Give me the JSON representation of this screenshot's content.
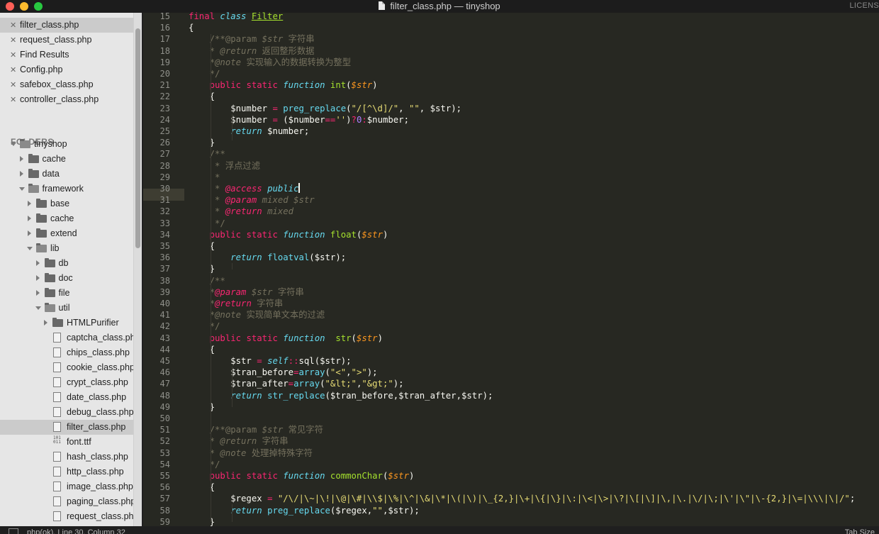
{
  "window": {
    "title": "filter_class.php — tinyshop",
    "right_cut_text": "LICENS"
  },
  "open_files": [
    {
      "label": "filter_class.php",
      "selected": true
    },
    {
      "label": "request_class.php"
    },
    {
      "label": "Find Results"
    },
    {
      "label": "Config.php"
    },
    {
      "label": "safebox_class.php"
    },
    {
      "label": "controller_class.php"
    }
  ],
  "folders_heading": "FOLDERS",
  "tree": [
    {
      "label": "tinyshop",
      "depth": 0,
      "kind": "folder",
      "state": "open"
    },
    {
      "label": "cache",
      "depth": 1,
      "kind": "folder",
      "state": "closed"
    },
    {
      "label": "data",
      "depth": 1,
      "kind": "folder",
      "state": "closed"
    },
    {
      "label": "framework",
      "depth": 1,
      "kind": "folder",
      "state": "open"
    },
    {
      "label": "base",
      "depth": 2,
      "kind": "folder",
      "state": "closed"
    },
    {
      "label": "cache",
      "depth": 2,
      "kind": "folder",
      "state": "closed"
    },
    {
      "label": "extend",
      "depth": 2,
      "kind": "folder",
      "state": "closed"
    },
    {
      "label": "lib",
      "depth": 2,
      "kind": "folder",
      "state": "open"
    },
    {
      "label": "db",
      "depth": 3,
      "kind": "folder",
      "state": "closed"
    },
    {
      "label": "doc",
      "depth": 3,
      "kind": "folder",
      "state": "closed"
    },
    {
      "label": "file",
      "depth": 3,
      "kind": "folder",
      "state": "closed"
    },
    {
      "label": "util",
      "depth": 3,
      "kind": "folder",
      "state": "open"
    },
    {
      "label": "HTMLPurifier",
      "depth": 4,
      "kind": "folder",
      "state": "closed"
    },
    {
      "label": "captcha_class.php",
      "depth": 4,
      "kind": "file"
    },
    {
      "label": "chips_class.php",
      "depth": 4,
      "kind": "file"
    },
    {
      "label": "cookie_class.php",
      "depth": 4,
      "kind": "file"
    },
    {
      "label": "crypt_class.php",
      "depth": 4,
      "kind": "file"
    },
    {
      "label": "date_class.php",
      "depth": 4,
      "kind": "file"
    },
    {
      "label": "debug_class.php",
      "depth": 4,
      "kind": "file"
    },
    {
      "label": "filter_class.php",
      "depth": 4,
      "kind": "file",
      "selected": true
    },
    {
      "label": "font.ttf",
      "depth": 4,
      "kind": "binary"
    },
    {
      "label": "hash_class.php",
      "depth": 4,
      "kind": "file"
    },
    {
      "label": "http_class.php",
      "depth": 4,
      "kind": "file"
    },
    {
      "label": "image_class.php",
      "depth": 4,
      "kind": "file"
    },
    {
      "label": "paging_class.php",
      "depth": 4,
      "kind": "file"
    },
    {
      "label": "request_class.php",
      "depth": 4,
      "kind": "file"
    }
  ],
  "editor": {
    "first_line": 15,
    "current_line": 30,
    "lines": [
      [
        [
          "kw",
          "final "
        ],
        [
          "st",
          "class "
        ],
        [
          "cls",
          "Filter"
        ]
      ],
      [
        [
          "",
          "{"
        ]
      ],
      [
        [
          "cm",
          "    /**@param "
        ],
        [
          "cmi",
          "$str"
        ],
        [
          "cm",
          " 字符串"
        ]
      ],
      [
        [
          "cm",
          "    * "
        ],
        [
          "cmi",
          "@return"
        ],
        [
          "cm",
          " 返回整形数据"
        ]
      ],
      [
        [
          "cm",
          "    *"
        ],
        [
          "cmi",
          "@note"
        ],
        [
          "cm",
          " 实现输入的数据转换为整型"
        ]
      ],
      [
        [
          "cm",
          "    */"
        ]
      ],
      [
        [
          "",
          "    "
        ],
        [
          "kw",
          "public static "
        ],
        [
          "st",
          "function "
        ],
        [
          "fn",
          "int"
        ],
        [
          "",
          "("
        ],
        [
          "vr",
          "$str"
        ],
        [
          "",
          ")"
        ]
      ],
      [
        [
          "",
          "    {"
        ]
      ],
      [
        [
          "",
          "        $number "
        ],
        [
          "kw",
          "= "
        ],
        [
          "ty",
          "preg_replace"
        ],
        [
          "",
          "("
        ],
        [
          "str",
          "\"/[^\\d]/\""
        ],
        [
          ",",
          ", "
        ],
        [
          "str",
          "\"\""
        ],
        [
          "",
          ", $str);"
        ]
      ],
      [
        [
          "",
          "        $number "
        ],
        [
          "kw",
          "= "
        ],
        [
          "",
          "($number"
        ],
        [
          "kw",
          "=="
        ],
        [
          "str",
          "''"
        ],
        [
          "",
          ")"
        ],
        [
          "kw",
          "?"
        ],
        [
          "num",
          "0"
        ],
        [
          "kw",
          ":"
        ],
        [
          "",
          "$number;"
        ]
      ],
      [
        [
          "",
          "        "
        ],
        [
          "st",
          "return "
        ],
        [
          "",
          "$number;"
        ]
      ],
      [
        [
          "",
          "    }"
        ]
      ],
      [
        [
          "cm",
          "    /**"
        ]
      ],
      [
        [
          "cm",
          "     * 浮点过滤"
        ]
      ],
      [
        [
          "cm",
          "     *"
        ]
      ],
      [
        [
          "cm",
          "     * "
        ],
        [
          "cmk",
          "@access "
        ],
        [
          "st",
          "public"
        ]
      ],
      [
        [
          "cm",
          "     * "
        ],
        [
          "cmk",
          "@param "
        ],
        [
          "cmi",
          "mixed $str"
        ]
      ],
      [
        [
          "cm",
          "     * "
        ],
        [
          "cmk",
          "@return "
        ],
        [
          "cmi",
          "mixed"
        ]
      ],
      [
        [
          "cm",
          "     */"
        ]
      ],
      [
        [
          "",
          "    "
        ],
        [
          "kw",
          "public static "
        ],
        [
          "st",
          "function "
        ],
        [
          "fn",
          "float"
        ],
        [
          "",
          "("
        ],
        [
          "vr",
          "$str"
        ],
        [
          "",
          ")"
        ]
      ],
      [
        [
          "",
          "    {"
        ]
      ],
      [
        [
          "",
          "        "
        ],
        [
          "st",
          "return "
        ],
        [
          "ty",
          "floatval"
        ],
        [
          "",
          "($str);"
        ]
      ],
      [
        [
          "",
          "    }"
        ]
      ],
      [
        [
          "cm",
          "    /**"
        ]
      ],
      [
        [
          "cm",
          "    *"
        ],
        [
          "cmk",
          "@param "
        ],
        [
          "cmi",
          "$str"
        ],
        [
          "cm",
          " 字符串"
        ]
      ],
      [
        [
          "cm",
          "    *"
        ],
        [
          "cmk",
          "@return "
        ],
        [
          "cm",
          "字符串"
        ]
      ],
      [
        [
          "cm",
          "    *"
        ],
        [
          "cmi",
          "@note"
        ],
        [
          "cm",
          " 实现简单文本的过滤"
        ]
      ],
      [
        [
          "cm",
          "    */"
        ]
      ],
      [
        [
          "",
          "    "
        ],
        [
          "kw",
          "public static "
        ],
        [
          "st",
          "function  "
        ],
        [
          "fn",
          "str"
        ],
        [
          "",
          "("
        ],
        [
          "vr",
          "$str"
        ],
        [
          "",
          ")"
        ]
      ],
      [
        [
          "",
          "    {"
        ]
      ],
      [
        [
          "",
          "        $str "
        ],
        [
          "kw",
          "= "
        ],
        [
          "st",
          "self"
        ],
        [
          "kw",
          "::"
        ],
        [
          "",
          "sql($str);"
        ]
      ],
      [
        [
          "",
          "        $tran_before"
        ],
        [
          "kw",
          "="
        ],
        [
          "ty",
          "array"
        ],
        [
          "",
          "("
        ],
        [
          "str",
          "\"<\""
        ],
        [
          "",
          ","
        ],
        [
          "str",
          "\">\""
        ],
        [
          "",
          ");"
        ]
      ],
      [
        [
          "",
          "        $tran_after"
        ],
        [
          "kw",
          "="
        ],
        [
          "ty",
          "array"
        ],
        [
          "",
          "("
        ],
        [
          "str",
          "\"&lt;\""
        ],
        [
          "",
          ","
        ],
        [
          "str",
          "\"&gt;\""
        ],
        [
          "",
          ");"
        ]
      ],
      [
        [
          "",
          "        "
        ],
        [
          "st",
          "return "
        ],
        [
          "ty",
          "str_replace"
        ],
        [
          "",
          "($tran_before,$tran_after,$str);"
        ]
      ],
      [
        [
          "",
          "    }"
        ]
      ],
      [
        [
          "",
          ""
        ]
      ],
      [
        [
          "cm",
          "    /**@param "
        ],
        [
          "cmi",
          "$str"
        ],
        [
          "cm",
          " 常见字符"
        ]
      ],
      [
        [
          "cm",
          "    * "
        ],
        [
          "cmi",
          "@return"
        ],
        [
          "cm",
          " 字符串"
        ]
      ],
      [
        [
          "cm",
          "    * "
        ],
        [
          "cmi",
          "@note"
        ],
        [
          "cm",
          " 处理掉特殊字符"
        ]
      ],
      [
        [
          "cm",
          "    */"
        ]
      ],
      [
        [
          "",
          "    "
        ],
        [
          "kw",
          "public static "
        ],
        [
          "st",
          "function "
        ],
        [
          "fn",
          "commonChar"
        ],
        [
          "",
          "("
        ],
        [
          "vr",
          "$str"
        ],
        [
          "",
          ")"
        ]
      ],
      [
        [
          "",
          "    {"
        ]
      ],
      [
        [
          "",
          "        $regex "
        ],
        [
          "kw",
          "= "
        ],
        [
          "str",
          "\"/\\/|\\~|\\!|\\@|\\#|\\\\$|\\%|\\^|\\&|\\*|\\(|\\)|\\_{2,}|\\+|\\{|\\}|\\:|\\<|\\>|\\?|\\[|\\]|\\,|\\.|\\/|\\;|\\'|\\\"|\\-{2,}|\\=|\\\\\\|\\|/\""
        ],
        [
          "",
          ";"
        ]
      ],
      [
        [
          "",
          "        "
        ],
        [
          "st",
          "return "
        ],
        [
          "ty",
          "preg_replace"
        ],
        [
          "",
          "($regex,"
        ],
        [
          "str",
          "\"\""
        ],
        [
          "",
          ",$str);"
        ]
      ],
      [
        [
          "",
          "    }"
        ]
      ]
    ]
  },
  "statusbar": {
    "left": "php(ok), Line 30, Column 32",
    "right": "Tab Size"
  }
}
